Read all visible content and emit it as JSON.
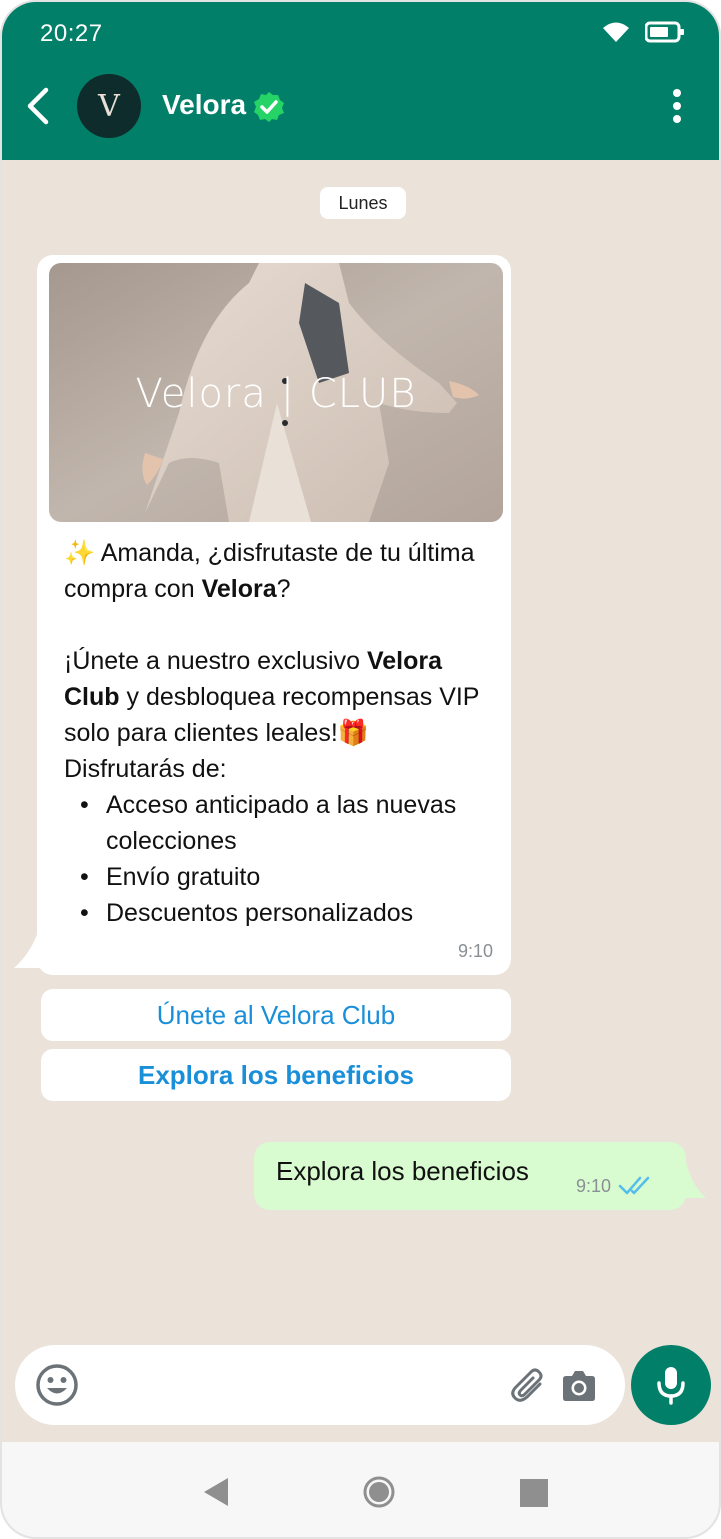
{
  "status_bar": {
    "time": "20:27",
    "icons": [
      "wifi-icon",
      "battery-icon"
    ]
  },
  "header": {
    "contact_name": "Velora",
    "avatar_letter": "V",
    "verified": true,
    "colors": {
      "bar": "#017f69",
      "verified": "#25d366"
    }
  },
  "chat": {
    "date_chip": "Lunes",
    "incoming": {
      "image_brand": "Velora",
      "image_sub": "CLUB",
      "greeting_emoji": "✨",
      "line1_a": " Amanda, ¿disfrutaste de tu última compra con ",
      "line1_bold": "Velora",
      "line1_b": "?",
      "line2_a": "¡Únete a nuestro exclusivo ",
      "line2_bold": "Velora Club",
      "line2_b": " y desbloquea recompensas VIP solo para clientes leales!",
      "gift_emoji": "🎁",
      "benefits_intro": "Disfrutarás de:",
      "benefits": [
        "Acceso anticipado a las nuevas colecciones",
        "Envío gratuito",
        "Descuentos personalizados"
      ],
      "time": "9:10"
    },
    "buttons": [
      {
        "label": "Únete al Velora Club"
      },
      {
        "label": "Explora los beneficios"
      }
    ],
    "outgoing": {
      "text": "Explora los beneficios",
      "time": "9:10",
      "status": "read"
    }
  },
  "composer": {
    "placeholder": ""
  },
  "navbar": {
    "icons": [
      "nav-back-icon",
      "nav-home-icon",
      "nav-recent-icon"
    ]
  }
}
